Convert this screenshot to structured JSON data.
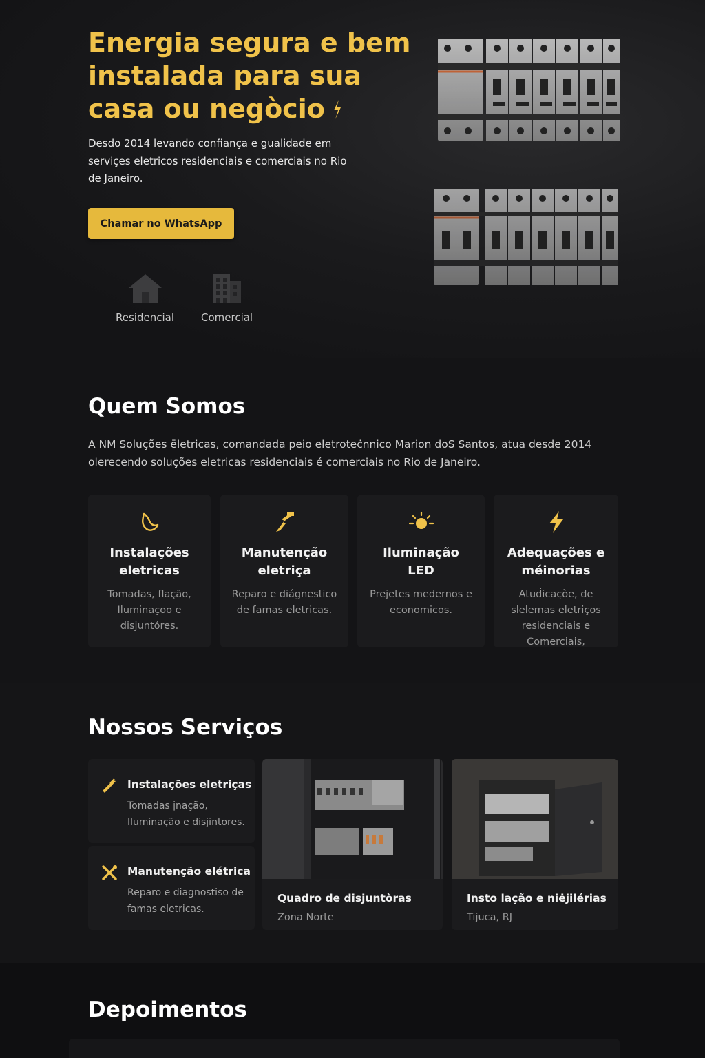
{
  "hero": {
    "title": "Energia segura e bem instalada para sua casa ou negòcio",
    "subtitle": "Desdo 2014 levando confiança e gualidade em serviçes eletricos residenciais e comerciais no Rio de Janeiro.",
    "cta_label": "Chamar no WhatsApp",
    "segments": [
      {
        "label": "Residencial",
        "icon": "house-icon"
      },
      {
        "label": "Comercial",
        "icon": "building-icon"
      }
    ]
  },
  "about": {
    "title": "Quem Somos",
    "text": "A NM Soluções ēletricas, comandada peio eletroteċnnico Marion doS Santos, atua desde 2014 olerecendo soluções eletricas residenciais é comerciais no Rio de Janeiro.",
    "features": [
      {
        "title": "Instalações eletricas",
        "desc": "Tomadas, flação, Iluminaçoo e disjuntóres.",
        "icon": "plug-icon"
      },
      {
        "title": "Manutenção eletriça",
        "desc": "Reparo e diágnestico de famas eletricas.",
        "icon": "bolt-plug-icon"
      },
      {
        "title": "Iluminação LED",
        "desc": "Prejetes medernos e economicos.",
        "icon": "sun-icon"
      },
      {
        "title": "Adequações e méinorias",
        "desc": "Atuḋicaçòe, de slelemas eletriços residenciais e Comerciais,",
        "icon": "lightning-icon"
      }
    ]
  },
  "services": {
    "title": "Nossos Serviços",
    "items": [
      {
        "title": "Instalações eletriças",
        "desc": "Tomadas ịnação, Iluminação e disjintores.",
        "icon": "pliers-icon"
      },
      {
        "title": "Manutenção elétrica",
        "desc": "Reparo e diagnostiso de famas eletricas.",
        "icon": "tools-icon"
      }
    ],
    "projects": [
      {
        "title": "Quadro de disjuntòras",
        "location": "Zona Norte"
      },
      {
        "title": "Insto lação e niėjilérias",
        "location": "Tijuca, RJ"
      }
    ]
  },
  "testimonials": {
    "title": "Depoimentos"
  },
  "colors": {
    "accent": "#f0c24a",
    "button": "#e6b93c",
    "background": "#141416",
    "card": "#1b1b1d"
  }
}
